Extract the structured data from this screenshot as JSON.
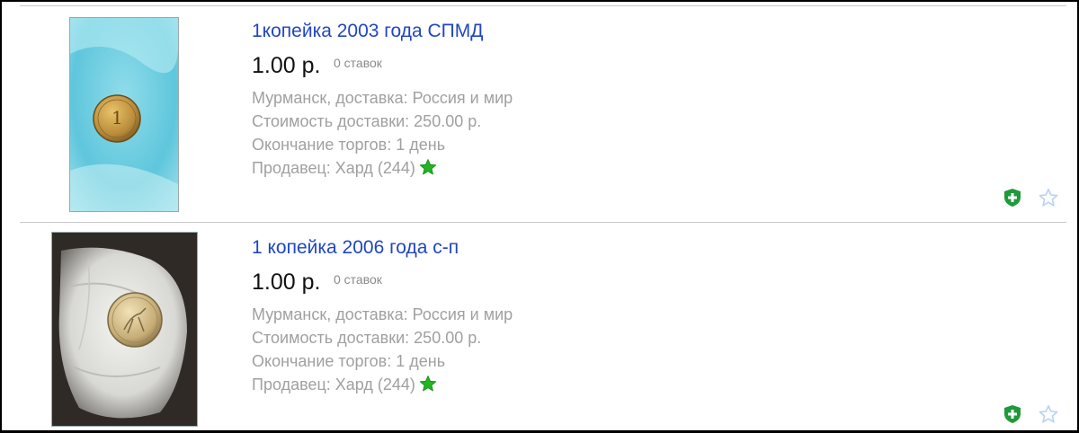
{
  "listings": [
    {
      "title": "1копейка 2003 года СПМД",
      "price": "1.00 р.",
      "bids": "0 ставок",
      "location": "Мурманск, доставка: Россия и мир",
      "shipping": "Стоимость доставки: 250.00 р.",
      "ends": "Окончание торгов: 1 день",
      "seller": "Продавец: Хард (244)",
      "seller_badge_icon": "green-star-icon",
      "actions": [
        "shield-plus-icon",
        "star-outline-icon"
      ]
    },
    {
      "title": "1 копейка 2006 года с-п",
      "price": "1.00 р.",
      "bids": "0 ставок",
      "location": "Мурманск, доставка: Россия и мир",
      "shipping": "Стоимость доставки: 250.00 р.",
      "ends": "Окончание торгов: 1 день",
      "seller": "Продавец: Хард (244)",
      "seller_badge_icon": "green-star-icon",
      "actions": [
        "shield-plus-icon",
        "star-outline-icon"
      ]
    }
  ],
  "colors": {
    "link": "#2046c0",
    "muted": "#a0a0a0",
    "badge_green": "#22b422",
    "shield_green": "#1f9a3a",
    "star_outline": "#b9d2f0"
  }
}
